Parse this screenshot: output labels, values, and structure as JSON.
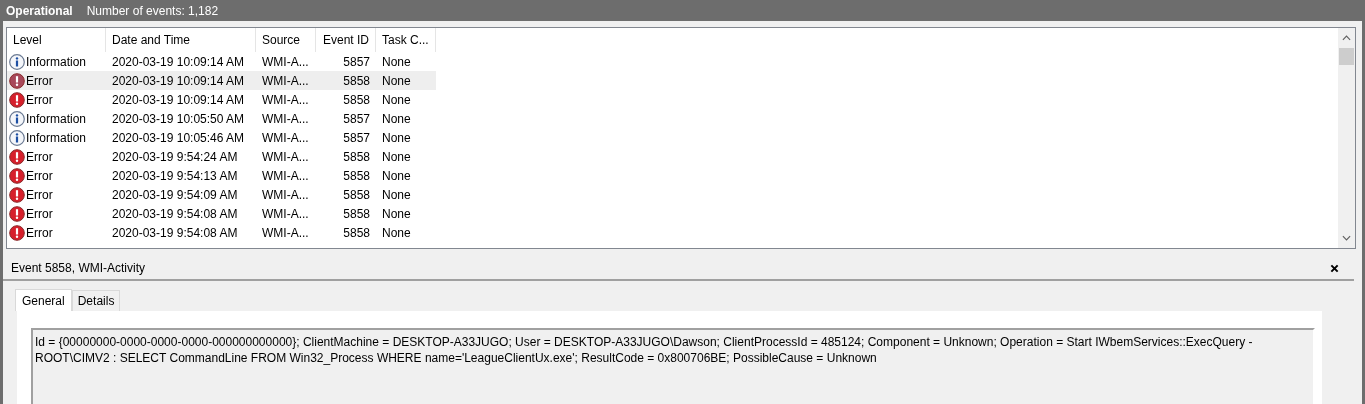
{
  "header": {
    "title": "Operational",
    "count": "Number of events: 1,182"
  },
  "table": {
    "columns": [
      "Level",
      "Date and Time",
      "Source",
      "Event ID",
      "Task C..."
    ],
    "rows": [
      {
        "kind": "information",
        "level": "Information",
        "date": "2020-03-19 10:09:14 AM",
        "source": "WMI-A...",
        "event_id": "5857",
        "task": "None",
        "selected": false
      },
      {
        "kind": "error",
        "level": "Error",
        "date": "2020-03-19 10:09:14 AM",
        "source": "WMI-A...",
        "event_id": "5858",
        "task": "None",
        "selected": true
      },
      {
        "kind": "error",
        "level": "Error",
        "date": "2020-03-19 10:09:14 AM",
        "source": "WMI-A...",
        "event_id": "5858",
        "task": "None",
        "selected": false
      },
      {
        "kind": "information",
        "level": "Information",
        "date": "2020-03-19 10:05:50 AM",
        "source": "WMI-A...",
        "event_id": "5857",
        "task": "None",
        "selected": false
      },
      {
        "kind": "information",
        "level": "Information",
        "date": "2020-03-19 10:05:46 AM",
        "source": "WMI-A...",
        "event_id": "5857",
        "task": "None",
        "selected": false
      },
      {
        "kind": "error",
        "level": "Error",
        "date": "2020-03-19 9:54:24 AM",
        "source": "WMI-A...",
        "event_id": "5858",
        "task": "None",
        "selected": false
      },
      {
        "kind": "error",
        "level": "Error",
        "date": "2020-03-19 9:54:13 AM",
        "source": "WMI-A...",
        "event_id": "5858",
        "task": "None",
        "selected": false
      },
      {
        "kind": "error",
        "level": "Error",
        "date": "2020-03-19 9:54:09 AM",
        "source": "WMI-A...",
        "event_id": "5858",
        "task": "None",
        "selected": false
      },
      {
        "kind": "error",
        "level": "Error",
        "date": "2020-03-19 9:54:08 AM",
        "source": "WMI-A...",
        "event_id": "5858",
        "task": "None",
        "selected": false
      },
      {
        "kind": "error",
        "level": "Error",
        "date": "2020-03-19 9:54:08 AM",
        "source": "WMI-A...",
        "event_id": "5858",
        "task": "None",
        "selected": false
      }
    ]
  },
  "detail": {
    "title": "Event 5858, WMI-Activity",
    "tabs": [
      {
        "label": "General",
        "selected": true
      },
      {
        "label": "Details",
        "selected": false
      }
    ],
    "message": "Id = {00000000-0000-0000-0000-000000000000}; ClientMachine = DESKTOP-A33JUGO; User = DESKTOP-A33JUGO\\Dawson; ClientProcessId = 485124; Component = Unknown; Operation = Start IWbemServices::ExecQuery - ROOT\\CIMV2 : SELECT CommandLine FROM Win32_Process WHERE name='LeagueClientUx.exe'; ResultCode = 0x800706BE; PossibleCause = Unknown"
  }
}
